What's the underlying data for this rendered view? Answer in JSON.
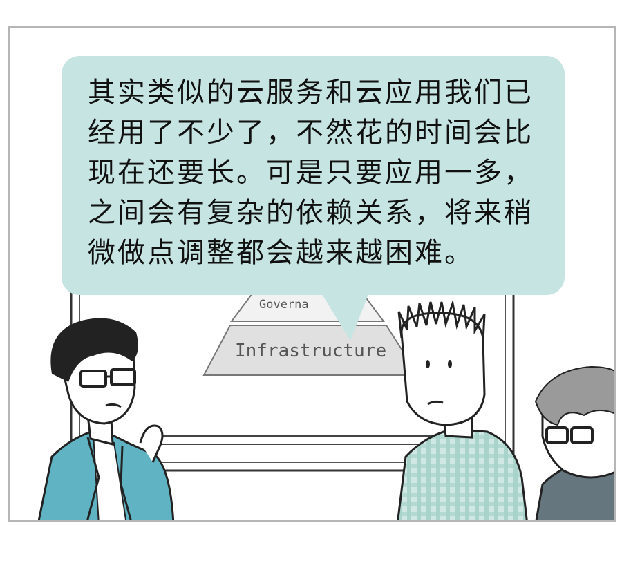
{
  "speech_bubble": {
    "text": "其实类似的云服务和云应用我们已\n经用了不少了，不然花的时间会比\n现在还要长。可是只要应用一多，\n之间会有复杂的依赖关系，将来稍\n微做点调整都会越来越困难。"
  },
  "whiteboard": {
    "pyramid_top_label": "Governa",
    "pyramid_bottom_label": "Infrastructure"
  },
  "colors": {
    "bubble": "#c6e4e1",
    "jacket": "#5fb3c3",
    "shirt_plaid": "#b9ddd6",
    "frame": "#b5b5b5"
  }
}
